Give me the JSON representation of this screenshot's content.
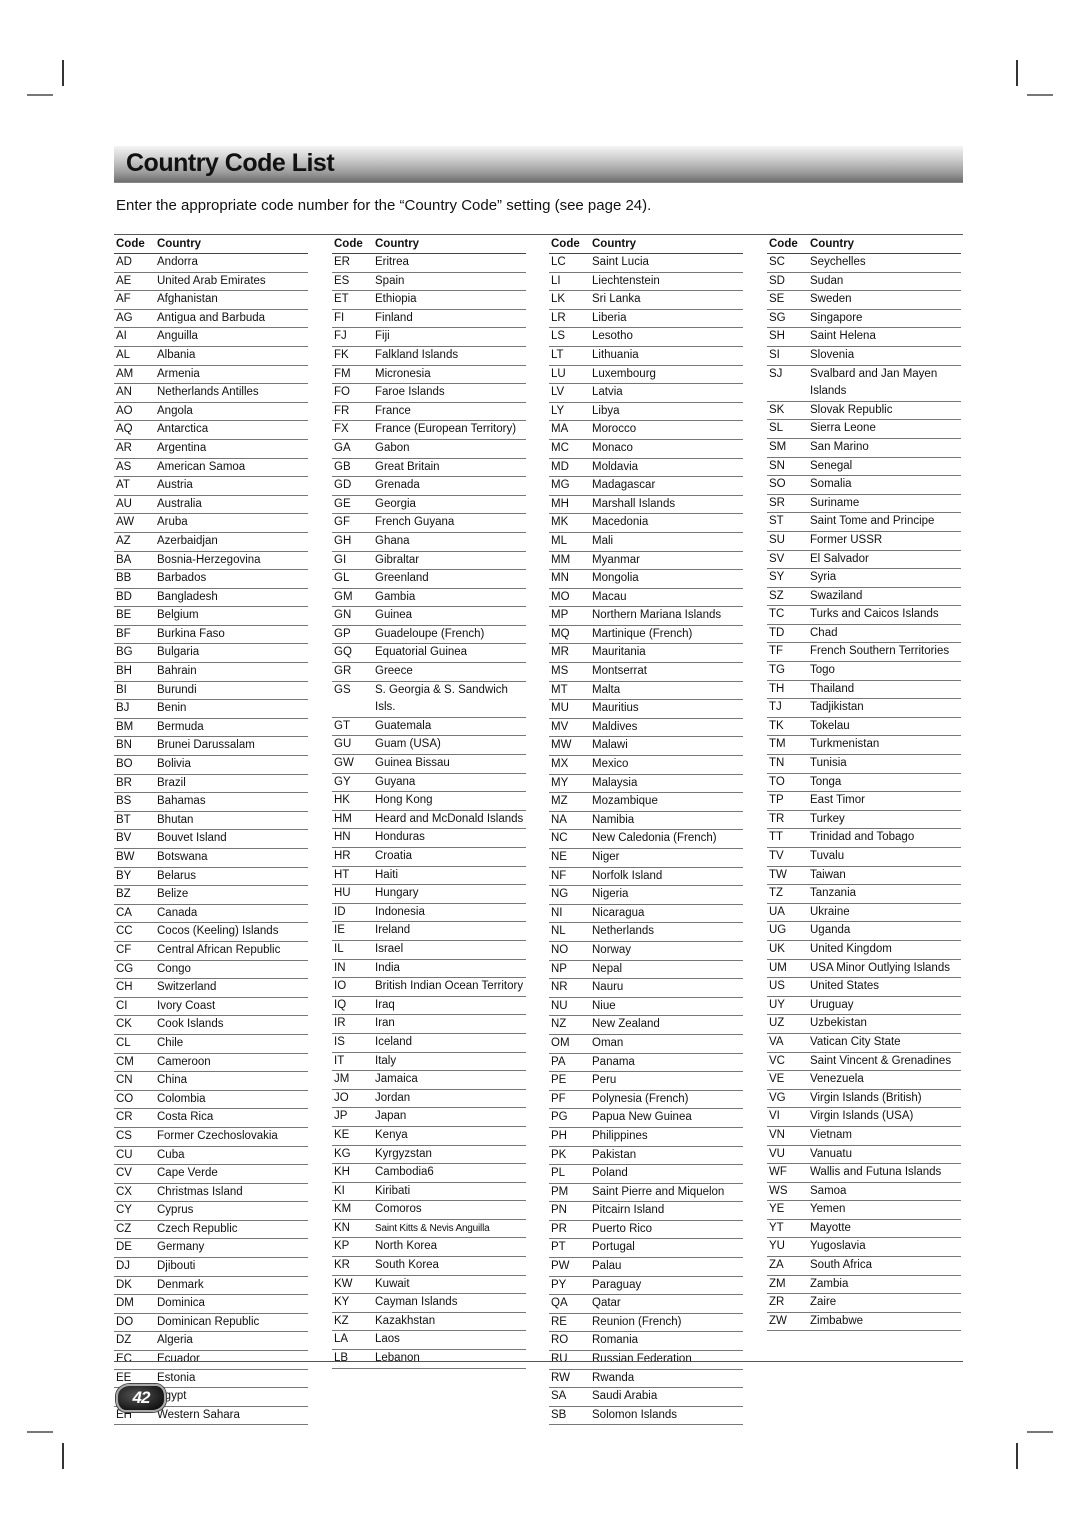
{
  "title": "Country Code List",
  "intro": "Enter the appropriate code number for the “Country Code” setting (see page 24).",
  "headers": {
    "code": "Code",
    "country": "Country"
  },
  "page_number": "42",
  "columns": [
    [
      [
        "AD",
        "Andorra"
      ],
      [
        "AE",
        "United Arab Emirates"
      ],
      [
        "AF",
        "Afghanistan"
      ],
      [
        "AG",
        "Antigua and Barbuda"
      ],
      [
        "AI",
        "Anguilla"
      ],
      [
        "AL",
        "Albania"
      ],
      [
        "AM",
        "Armenia"
      ],
      [
        "AN",
        "Netherlands Antilles"
      ],
      [
        "AO",
        "Angola"
      ],
      [
        "AQ",
        "Antarctica"
      ],
      [
        "AR",
        "Argentina"
      ],
      [
        "AS",
        "American Samoa"
      ],
      [
        "AT",
        "Austria"
      ],
      [
        "AU",
        "Australia"
      ],
      [
        "AW",
        "Aruba"
      ],
      [
        "AZ",
        "Azerbaidjan"
      ],
      [
        "BA",
        "Bosnia-Herzegovina"
      ],
      [
        "BB",
        "Barbados"
      ],
      [
        "BD",
        "Bangladesh"
      ],
      [
        "BE",
        "Belgium"
      ],
      [
        "BF",
        "Burkina Faso"
      ],
      [
        "BG",
        "Bulgaria"
      ],
      [
        "BH",
        "Bahrain"
      ],
      [
        "BI",
        "Burundi"
      ],
      [
        "BJ",
        "Benin"
      ],
      [
        "BM",
        "Bermuda"
      ],
      [
        "BN",
        "Brunei Darussalam"
      ],
      [
        "BO",
        "Bolivia"
      ],
      [
        "BR",
        "Brazil"
      ],
      [
        "BS",
        "Bahamas"
      ],
      [
        "BT",
        "Bhutan"
      ],
      [
        "BV",
        "Bouvet Island"
      ],
      [
        "BW",
        "Botswana"
      ],
      [
        "BY",
        "Belarus"
      ],
      [
        "BZ",
        "Belize"
      ],
      [
        "CA",
        "Canada"
      ],
      [
        "CC",
        "Cocos (Keeling) Islands"
      ],
      [
        "CF",
        "Central African Republic"
      ],
      [
        "CG",
        "Congo"
      ],
      [
        "CH",
        "Switzerland"
      ],
      [
        "CI",
        "Ivory Coast"
      ],
      [
        "CK",
        "Cook Islands"
      ],
      [
        "CL",
        "Chile"
      ],
      [
        "CM",
        "Cameroon"
      ],
      [
        "CN",
        "China"
      ],
      [
        "CO",
        "Colombia"
      ],
      [
        "CR",
        "Costa Rica"
      ],
      [
        "CS",
        "Former Czechoslovakia"
      ],
      [
        "CU",
        "Cuba"
      ],
      [
        "CV",
        "Cape Verde"
      ],
      [
        "CX",
        "Christmas Island"
      ],
      [
        "CY",
        "Cyprus"
      ],
      [
        "CZ",
        "Czech Republic"
      ],
      [
        "DE",
        "Germany"
      ],
      [
        "DJ",
        "Djibouti"
      ],
      [
        "DK",
        "Denmark"
      ],
      [
        "DM",
        "Dominica"
      ],
      [
        "DO",
        "Dominican Republic"
      ],
      [
        "DZ",
        "Algeria"
      ],
      [
        "EC",
        "Ecuador"
      ],
      [
        "EE",
        "Estonia"
      ],
      [
        "EG",
        "Egypt"
      ],
      [
        "EH",
        "Western Sahara"
      ]
    ],
    [
      [
        "ER",
        "Eritrea"
      ],
      [
        "ES",
        "Spain"
      ],
      [
        "ET",
        "Ethiopia"
      ],
      [
        "FI",
        "Finland"
      ],
      [
        "FJ",
        "Fiji"
      ],
      [
        "FK",
        "Falkland Islands"
      ],
      [
        "FM",
        "Micronesia"
      ],
      [
        "FO",
        "Faroe Islands"
      ],
      [
        "FR",
        "France"
      ],
      [
        "FX",
        "France (European Territory)"
      ],
      [
        "GA",
        "Gabon"
      ],
      [
        "GB",
        "Great Britain"
      ],
      [
        "GD",
        "Grenada"
      ],
      [
        "GE",
        "Georgia"
      ],
      [
        "GF",
        "French Guyana"
      ],
      [
        "GH",
        "Ghana"
      ],
      [
        "GI",
        "Gibraltar"
      ],
      [
        "GL",
        "Greenland"
      ],
      [
        "GM",
        "Gambia"
      ],
      [
        "GN",
        "Guinea"
      ],
      [
        "GP",
        "Guadeloupe (French)"
      ],
      [
        "GQ",
        "Equatorial Guinea"
      ],
      [
        "GR",
        "Greece"
      ],
      [
        "GS",
        "S. Georgia & S. Sandwich Isls."
      ],
      [
        "GT",
        "Guatemala"
      ],
      [
        "GU",
        "Guam (USA)"
      ],
      [
        "GW",
        "Guinea Bissau"
      ],
      [
        "GY",
        "Guyana"
      ],
      [
        "HK",
        "Hong Kong"
      ],
      [
        "HM",
        "Heard and McDonald Islands"
      ],
      [
        "HN",
        "Honduras"
      ],
      [
        "HR",
        "Croatia"
      ],
      [
        "HT",
        "Haiti"
      ],
      [
        "HU",
        "Hungary"
      ],
      [
        "ID",
        "Indonesia"
      ],
      [
        "IE",
        "Ireland"
      ],
      [
        "IL",
        "Israel"
      ],
      [
        "IN",
        "India"
      ],
      [
        "IO",
        "British Indian Ocean Territory"
      ],
      [
        "IQ",
        "Iraq"
      ],
      [
        "IR",
        "Iran"
      ],
      [
        "IS",
        "Iceland"
      ],
      [
        "IT",
        "Italy"
      ],
      [
        "JM",
        "Jamaica"
      ],
      [
        "JO",
        "Jordan"
      ],
      [
        "JP",
        "Japan"
      ],
      [
        "KE",
        "Kenya"
      ],
      [
        "KG",
        "Kyrgyzstan"
      ],
      [
        "KH",
        "Cambodia6"
      ],
      [
        "KI",
        "Kiribati"
      ],
      [
        "KM",
        "Comoros"
      ],
      [
        "KN",
        "Saint Kitts & Nevis Anguilla"
      ],
      [
        "KP",
        "North Korea"
      ],
      [
        "KR",
        "South Korea"
      ],
      [
        "KW",
        "Kuwait"
      ],
      [
        "KY",
        "Cayman Islands"
      ],
      [
        "KZ",
        "Kazakhstan"
      ],
      [
        "LA",
        "Laos"
      ],
      [
        "LB",
        "Lebanon"
      ]
    ],
    [
      [
        "LC",
        "Saint Lucia"
      ],
      [
        "LI",
        "Liechtenstein"
      ],
      [
        "LK",
        "Sri Lanka"
      ],
      [
        "LR",
        "Liberia"
      ],
      [
        "LS",
        "Lesotho"
      ],
      [
        "LT",
        "Lithuania"
      ],
      [
        "LU",
        "Luxembourg"
      ],
      [
        "LV",
        "Latvia"
      ],
      [
        "LY",
        "Libya"
      ],
      [
        "MA",
        "Morocco"
      ],
      [
        "MC",
        "Monaco"
      ],
      [
        "MD",
        "Moldavia"
      ],
      [
        "MG",
        "Madagascar"
      ],
      [
        "MH",
        "Marshall Islands"
      ],
      [
        "MK",
        "Macedonia"
      ],
      [
        "ML",
        "Mali"
      ],
      [
        "MM",
        "Myanmar"
      ],
      [
        "MN",
        "Mongolia"
      ],
      [
        "MO",
        "Macau"
      ],
      [
        "MP",
        "Northern Mariana Islands"
      ],
      [
        "MQ",
        "Martinique (French)"
      ],
      [
        "MR",
        "Mauritania"
      ],
      [
        "MS",
        "Montserrat"
      ],
      [
        "MT",
        "Malta"
      ],
      [
        "MU",
        "Mauritius"
      ],
      [
        "MV",
        "Maldives"
      ],
      [
        "MW",
        "Malawi"
      ],
      [
        "MX",
        "Mexico"
      ],
      [
        "MY",
        "Malaysia"
      ],
      [
        "MZ",
        "Mozambique"
      ],
      [
        "NA",
        "Namibia"
      ],
      [
        "NC",
        "New Caledonia (French)"
      ],
      [
        "NE",
        "Niger"
      ],
      [
        "NF",
        "Norfolk Island"
      ],
      [
        "NG",
        "Nigeria"
      ],
      [
        "NI",
        "Nicaragua"
      ],
      [
        "NL",
        "Netherlands"
      ],
      [
        "NO",
        "Norway"
      ],
      [
        "NP",
        "Nepal"
      ],
      [
        "NR",
        "Nauru"
      ],
      [
        "NU",
        "Niue"
      ],
      [
        "NZ",
        "New Zealand"
      ],
      [
        "OM",
        "Oman"
      ],
      [
        "PA",
        "Panama"
      ],
      [
        "PE",
        "Peru"
      ],
      [
        "PF",
        "Polynesia (French)"
      ],
      [
        "PG",
        "Papua New Guinea"
      ],
      [
        "PH",
        "Philippines"
      ],
      [
        "PK",
        "Pakistan"
      ],
      [
        "PL",
        "Poland"
      ],
      [
        "PM",
        "Saint Pierre and Miquelon"
      ],
      [
        "PN",
        "Pitcairn Island"
      ],
      [
        "PR",
        "Puerto Rico"
      ],
      [
        "PT",
        "Portugal"
      ],
      [
        "PW",
        "Palau"
      ],
      [
        "PY",
        "Paraguay"
      ],
      [
        "QA",
        "Qatar"
      ],
      [
        "RE",
        "Reunion (French)"
      ],
      [
        "RO",
        "Romania"
      ],
      [
        "RU",
        "Russian Federation"
      ],
      [
        "RW",
        "Rwanda"
      ],
      [
        "SA",
        "Saudi Arabia"
      ],
      [
        "SB",
        "Solomon Islands"
      ]
    ],
    [
      [
        "SC",
        "Seychelles"
      ],
      [
        "SD",
        "Sudan"
      ],
      [
        "SE",
        "Sweden"
      ],
      [
        "SG",
        "Singapore"
      ],
      [
        "SH",
        "Saint Helena"
      ],
      [
        "SI",
        "Slovenia"
      ],
      [
        "SJ",
        "Svalbard and Jan Mayen Islands"
      ],
      [
        "SK",
        "Slovak Republic"
      ],
      [
        "SL",
        "Sierra Leone"
      ],
      [
        "SM",
        "San Marino"
      ],
      [
        "SN",
        "Senegal"
      ],
      [
        "SO",
        "Somalia"
      ],
      [
        "SR",
        "Suriname"
      ],
      [
        "ST",
        "Saint Tome and Principe"
      ],
      [
        "SU",
        "Former USSR"
      ],
      [
        "SV",
        "El Salvador"
      ],
      [
        "SY",
        "Syria"
      ],
      [
        "SZ",
        "Swaziland"
      ],
      [
        "TC",
        "Turks and Caicos Islands"
      ],
      [
        "TD",
        "Chad"
      ],
      [
        "TF",
        "French Southern Territories"
      ],
      [
        "TG",
        "Togo"
      ],
      [
        "TH",
        "Thailand"
      ],
      [
        "TJ",
        "Tadjikistan"
      ],
      [
        "TK",
        "Tokelau"
      ],
      [
        "TM",
        "Turkmenistan"
      ],
      [
        "TN",
        "Tunisia"
      ],
      [
        "TO",
        "Tonga"
      ],
      [
        "TP",
        "East Timor"
      ],
      [
        "TR",
        "Turkey"
      ],
      [
        "TT",
        "Trinidad and Tobago"
      ],
      [
        "TV",
        "Tuvalu"
      ],
      [
        "TW",
        "Taiwan"
      ],
      [
        "TZ",
        "Tanzania"
      ],
      [
        "UA",
        "Ukraine"
      ],
      [
        "UG",
        "Uganda"
      ],
      [
        "UK",
        "United Kingdom"
      ],
      [
        "UM",
        "USA Minor Outlying Islands"
      ],
      [
        "US",
        "United States"
      ],
      [
        "UY",
        "Uruguay"
      ],
      [
        "UZ",
        "Uzbekistan"
      ],
      [
        "VA",
        "Vatican City State"
      ],
      [
        "VC",
        "Saint Vincent & Grenadines"
      ],
      [
        "VE",
        "Venezuela"
      ],
      [
        "VG",
        "Virgin Islands (British)"
      ],
      [
        "VI",
        "Virgin Islands (USA)"
      ],
      [
        "VN",
        "Vietnam"
      ],
      [
        "VU",
        "Vanuatu"
      ],
      [
        "WF",
        "Wallis and Futuna Islands"
      ],
      [
        "WS",
        "Samoa"
      ],
      [
        "YE",
        "Yemen"
      ],
      [
        "YT",
        "Mayotte"
      ],
      [
        "YU",
        "Yugoslavia"
      ],
      [
        "ZA",
        "South Africa"
      ],
      [
        "ZM",
        "Zambia"
      ],
      [
        "ZR",
        "Zaire"
      ],
      [
        "ZW",
        "Zimbabwe"
      ]
    ]
  ]
}
